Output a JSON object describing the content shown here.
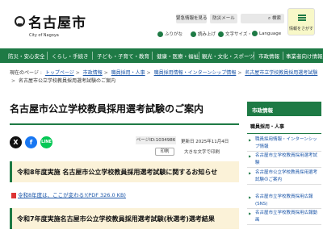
{
  "header": {
    "logo_name": "名古屋市",
    "logo_sub": "City of Nagoya",
    "emergency_label": "緊急情報を見る",
    "disaster_label": "防災メール",
    "search_label": "検索",
    "furigana_label": "ふりがな",
    "voice_label": "読み上げ",
    "text_size_label": "文字サイズ・色",
    "language_label": "Language",
    "info_menu_label": "情報をさがす"
  },
  "global_nav": [
    "防災・安心安全",
    "くらし・手続き",
    "子ども・子育て・教育",
    "健康・医療・福祉",
    "観光・文化・スポーツ",
    "市政情報",
    "事業者向け情報"
  ],
  "breadcrumb": [
    "現在のページ",
    "トップページ",
    "市政情報",
    "職員採用・人事",
    "職員採用情報・インターンシップ情報",
    "名古屋市立学校教員採用選考試験",
    "名古屋市公立学校教員採用選考試験のご案内"
  ],
  "page_title": "名古屋市公立学校教員採用選考試験のご案内",
  "share": {
    "x": "X",
    "facebook": "f",
    "line": "LINE"
  },
  "meta": {
    "page_id": "ページID:1034986",
    "updated": "更新日 2025年11月4日",
    "print_label": "印刷",
    "large_text_label": "大きな文字で印刷"
  },
  "sections": [
    {
      "title": "令和8年度実施 名古屋市公立学校教員採用選考試験に関するお知らせ"
    },
    {
      "title": "令和7年度実施名古屋市公立学校教員採用選考試験(秋選考)選考結果"
    }
  ],
  "pdf_link": "令和8年度は、ここが変わる!(PDF 326.0 KB)",
  "sidebar": {
    "heading": "市政情報",
    "sub_heading": "職員採用・人事",
    "items": [
      "職員採用情報・インターンシップ情報",
      "名古屋市立学校教員採用選考試験",
      "名古屋市公立学校教員採用選考試験のご案内",
      "名古屋市立学校教員採用広報(SNS)",
      "名古屋市立学校教員採用広報動画"
    ]
  }
}
